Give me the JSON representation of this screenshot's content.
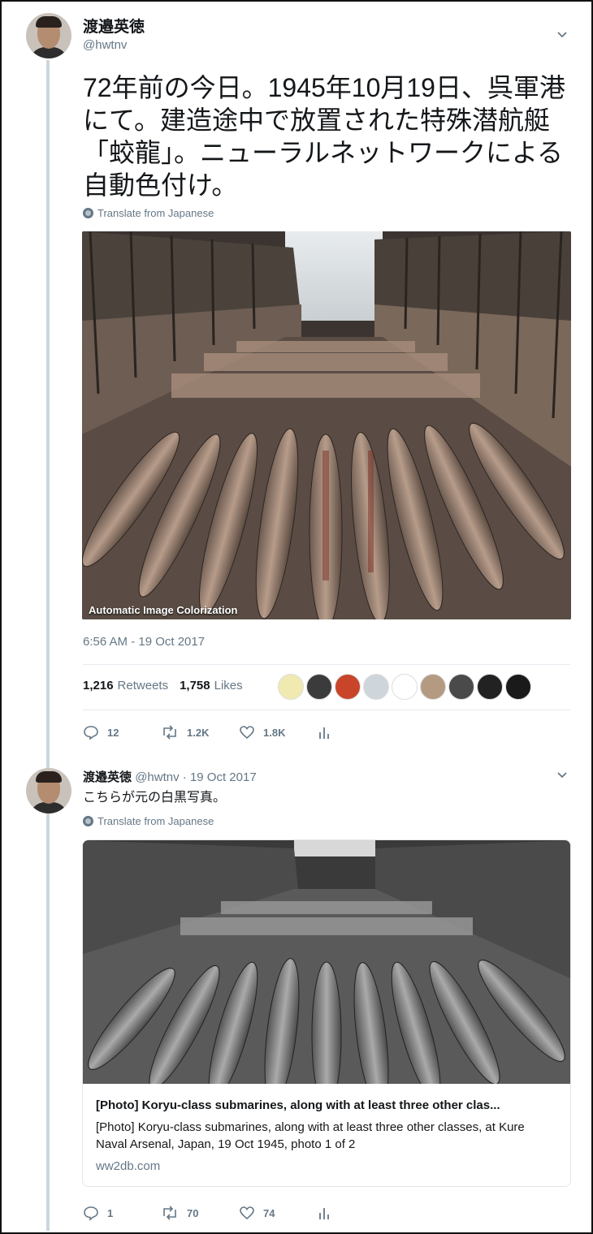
{
  "tweet1": {
    "author_name": "渡邉英徳",
    "author_handle": "@hwtnv",
    "text": "72年前の今日。1945年10月19日、呉軍港にて。建造途中で放置された特殊潜航艇「蛟龍」。ニューラルネットワークによる自動色付け。",
    "translate_label": "Translate from Japanese",
    "image_caption": "Automatic Image Colorization",
    "timestamp": "6:56 AM - 19 Oct 2017",
    "retweets_count": "1,216",
    "retweets_label": "Retweets",
    "likes_count": "1,758",
    "likes_label": "Likes",
    "reply_count": "12",
    "retweet_count_short": "1.2K",
    "like_count_short": "1.8K"
  },
  "tweet2": {
    "author_name": "渡邉英徳",
    "author_handle": "@hwtnv",
    "date_meta": "· 19 Oct 2017",
    "text": "こちらが元の白黒写真。",
    "translate_label": "Translate from Japanese",
    "card_title": "[Photo] Koryu-class submarines, along with at least three other clas...",
    "card_description": "[Photo] Koryu-class submarines, along with at least three other classes, at Kure Naval Arsenal, Japan, 19 Oct 1945, photo 1 of 2",
    "card_domain": "ww2db.com",
    "reply_count": "1",
    "retweet_count": "70",
    "like_count": "74"
  },
  "colors": {
    "accent_gray": "#657786",
    "thread_line": "#ccd6dd"
  }
}
